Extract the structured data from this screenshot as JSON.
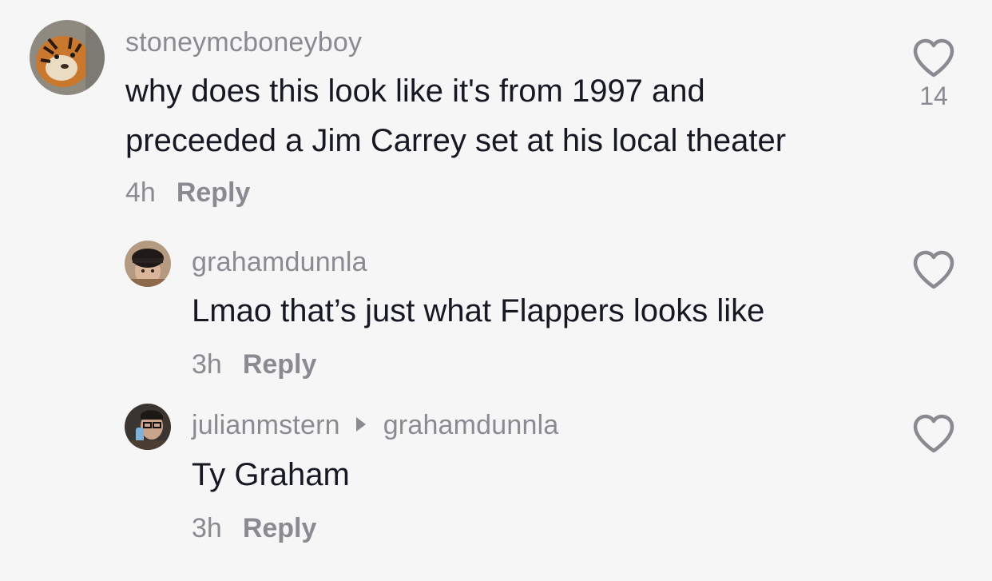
{
  "comments": [
    {
      "username": "stoneymcboneyboy",
      "text_line1": "why does this look like it's from 1997 and",
      "text_line2": "preceeded a Jim Carrey set at his local theater",
      "time": "4h",
      "reply_label": "Reply",
      "likes": "14",
      "avatar_icon": "tiger-avatar"
    },
    {
      "username": "grahamdunnla",
      "text": "Lmao that’s just what Flappers looks like",
      "time": "3h",
      "reply_label": "Reply",
      "avatar_icon": "person-hat-avatar"
    },
    {
      "username": "julianmstern",
      "reply_to": "grahamdunnla",
      "text": "Ty Graham",
      "time": "3h",
      "reply_label": "Reply",
      "avatar_icon": "person-glasses-avatar"
    }
  ],
  "heart_icon": "heart-outline-icon",
  "colors": {
    "background": "#f6f6f6",
    "primary_text": "#161823",
    "secondary_text": "#8a8b91"
  }
}
